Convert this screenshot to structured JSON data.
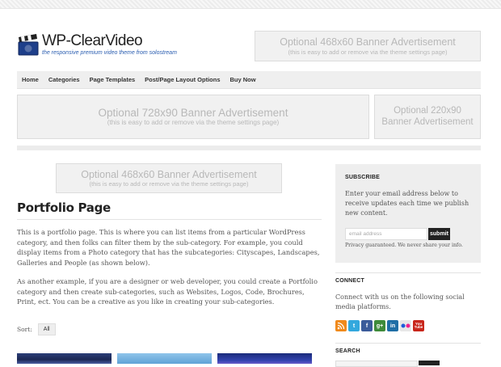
{
  "site": {
    "title": "WP-ClearVideo",
    "tagline": "the responsive premium video theme from solostream"
  },
  "ads": {
    "header": {
      "title": "Optional 468x60 Banner Advertisement",
      "note": "(this is easy to add or remove via the theme settings page)"
    },
    "leaderboard": {
      "title": "Optional 728x90 Banner Advertisement",
      "note": "(this is easy to add or remove via the theme settings page)"
    },
    "side_banner": {
      "line1": "Optional 220x90",
      "line2": "Banner Advertisement"
    },
    "content": {
      "title": "Optional 468x60 Banner Advertisement",
      "note": "(this is easy to add or remove via the theme settings page)"
    }
  },
  "nav": {
    "items": [
      "Home",
      "Categories",
      "Page Templates",
      "Post/Page Layout Options",
      "Buy Now"
    ]
  },
  "page": {
    "title": "Portfolio Page",
    "paragraphs": [
      "This is a portfolio page. This is where you can list items from a particular WordPress category, and then folks can filter them by the sub-category. For example, you could display items from a Photo category that has the subcategories: Cityscapes, Landscapes, Galleries and People (as shown below).",
      "As another example, if you are a designer or web developer, you could create a Portfolio category and then create sub-categories, such as Websites, Logos, Code, Brochures, Print, ect. You can be a creative as you like in creating your sub-categories."
    ],
    "sort_label": "Sort:",
    "sort_option": "All"
  },
  "sidebar": {
    "subscribe": {
      "title": "SUBSCRIBE",
      "text": "Enter your email address below to receive updates each time we publish new content.",
      "placeholder": "email address",
      "button": "submit",
      "privacy": "Privacy guaranteed. We never share your info."
    },
    "connect": {
      "title": "CONNECT",
      "text": "Connect with us on the following social media platforms.",
      "icons": [
        {
          "name": "rss-icon",
          "glyph": "",
          "color": "#f08a1c"
        },
        {
          "name": "twitter-icon",
          "glyph": "t",
          "color": "#33a8dd"
        },
        {
          "name": "facebook-icon",
          "glyph": "f",
          "color": "#3b5b9a"
        },
        {
          "name": "google-plus-icon",
          "glyph": "g+",
          "color": "#3f8b3a"
        },
        {
          "name": "linkedin-icon",
          "glyph": "in",
          "color": "#1f6ea6"
        },
        {
          "name": "flickr-icon",
          "glyph": "",
          "color": "#e7e7e7"
        },
        {
          "name": "youtube-icon",
          "glyph": "You Tube",
          "color": "#c8261b"
        }
      ]
    },
    "search": {
      "title": "SEARCH"
    }
  }
}
